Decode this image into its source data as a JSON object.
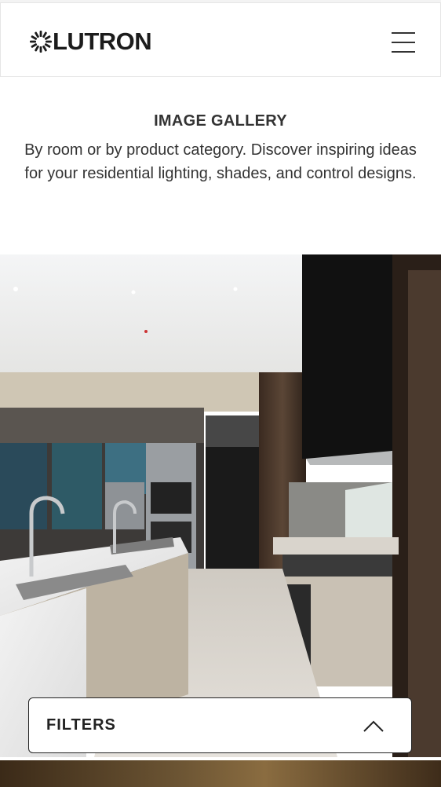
{
  "header": {
    "brand": "LUTRON",
    "logo_icon": "lutron-sunburst-icon",
    "menu_icon": "hamburger-menu-icon"
  },
  "intro": {
    "title": "IMAGE GALLERY",
    "description": "By room or by product category. Discover inspiring ideas for your residential lighting, shades, and control designs."
  },
  "gallery": {
    "hero_image": "modern kitchen with marble island, stainless ovens and black range hood"
  },
  "filters": {
    "label": "FILTERS",
    "toggle_icon": "chevron-up-icon"
  },
  "colors": {
    "brand_text": "#1c1c1c",
    "body_text": "#333333",
    "border": "#222222"
  }
}
